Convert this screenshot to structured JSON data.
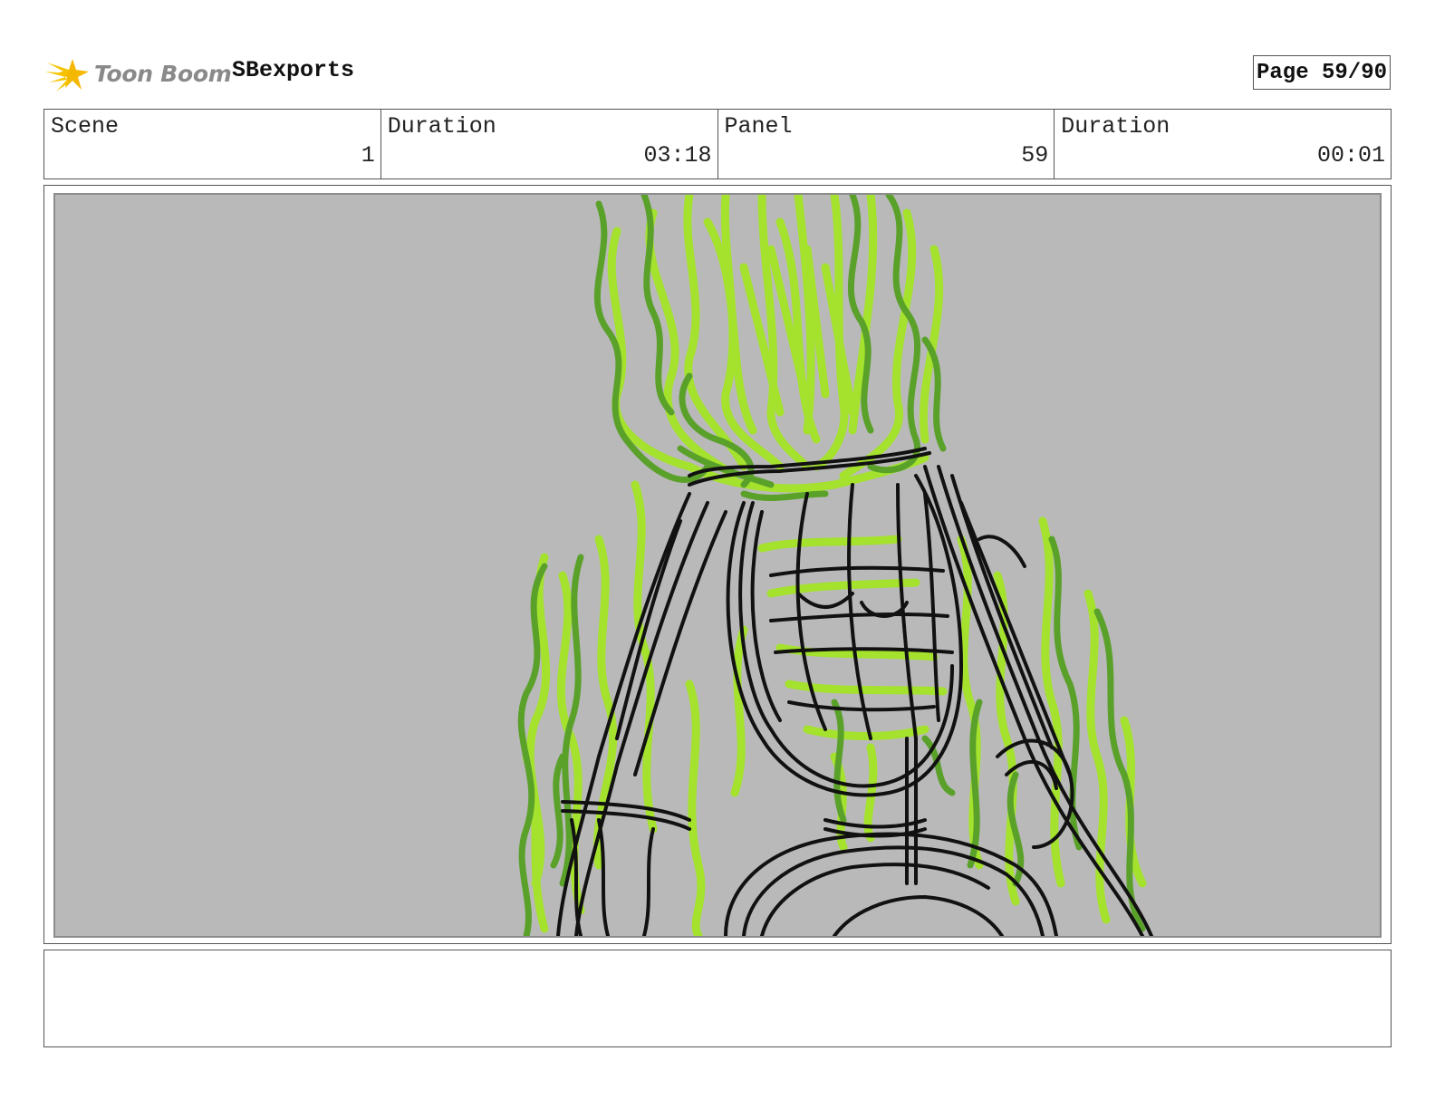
{
  "header": {
    "logo_text": "Toon Boom",
    "project_name": "SBexports",
    "page_label": "Page 59/90"
  },
  "info": [
    {
      "label": "Scene",
      "value": "1"
    },
    {
      "label": "Duration",
      "value": "03:18"
    },
    {
      "label": "Panel",
      "value": "59"
    },
    {
      "label": "Duration",
      "value": "00:01"
    }
  ],
  "panel": {
    "background_color": "#b9b9b9",
    "sketch_colors": {
      "ink": "#111111",
      "flame_light": "#a4e22e",
      "flame_dark": "#5aa12a"
    }
  },
  "notes": {
    "text": ""
  }
}
